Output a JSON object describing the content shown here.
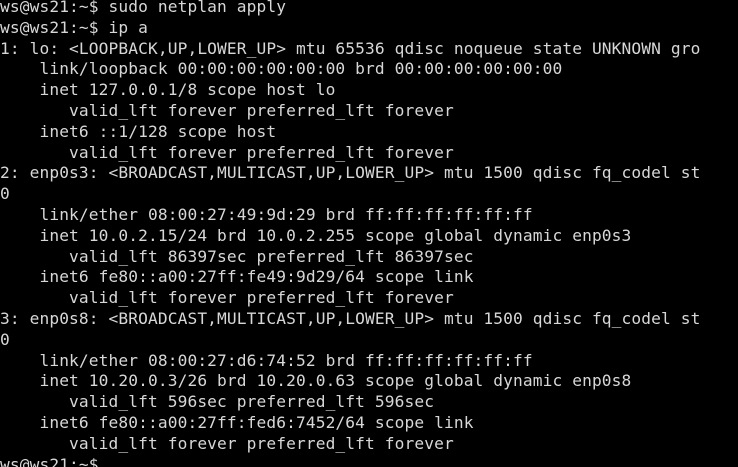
{
  "terminal": {
    "background": "#000000",
    "foreground": "#d7d7d7",
    "lines": [
      "ws@ws21:~$ sudo netplan apply",
      "ws@ws21:~$ ip a",
      "1: lo: <LOOPBACK,UP,LOWER_UP> mtu 65536 qdisc noqueue state UNKNOWN gro",
      "    link/loopback 00:00:00:00:00:00 brd 00:00:00:00:00:00",
      "    inet 127.0.0.1/8 scope host lo",
      "       valid_lft forever preferred_lft forever",
      "    inet6 ::1/128 scope host",
      "       valid_lft forever preferred_lft forever",
      "2: enp0s3: <BROADCAST,MULTICAST,UP,LOWER_UP> mtu 1500 qdisc fq_codel st",
      "0",
      "    link/ether 08:00:27:49:9d:29 brd ff:ff:ff:ff:ff:ff",
      "    inet 10.0.2.15/24 brd 10.0.2.255 scope global dynamic enp0s3",
      "       valid_lft 86397sec preferred_lft 86397sec",
      "    inet6 fe80::a00:27ff:fe49:9d29/64 scope link",
      "       valid_lft forever preferred_lft forever",
      "3: enp0s8: <BROADCAST,MULTICAST,UP,LOWER_UP> mtu 1500 qdisc fq_codel st",
      "0",
      "    link/ether 08:00:27:d6:74:52 brd ff:ff:ff:ff:ff:ff",
      "    inet 10.20.0.3/26 brd 10.20.0.63 scope global dynamic enp0s8",
      "       valid_lft 596sec preferred_lft 596sec",
      "    inet6 fe80::a00:27ff:fed6:7452/64 scope link",
      "       valid_lft forever preferred_lft forever",
      "ws@ws21:~$ "
    ]
  }
}
